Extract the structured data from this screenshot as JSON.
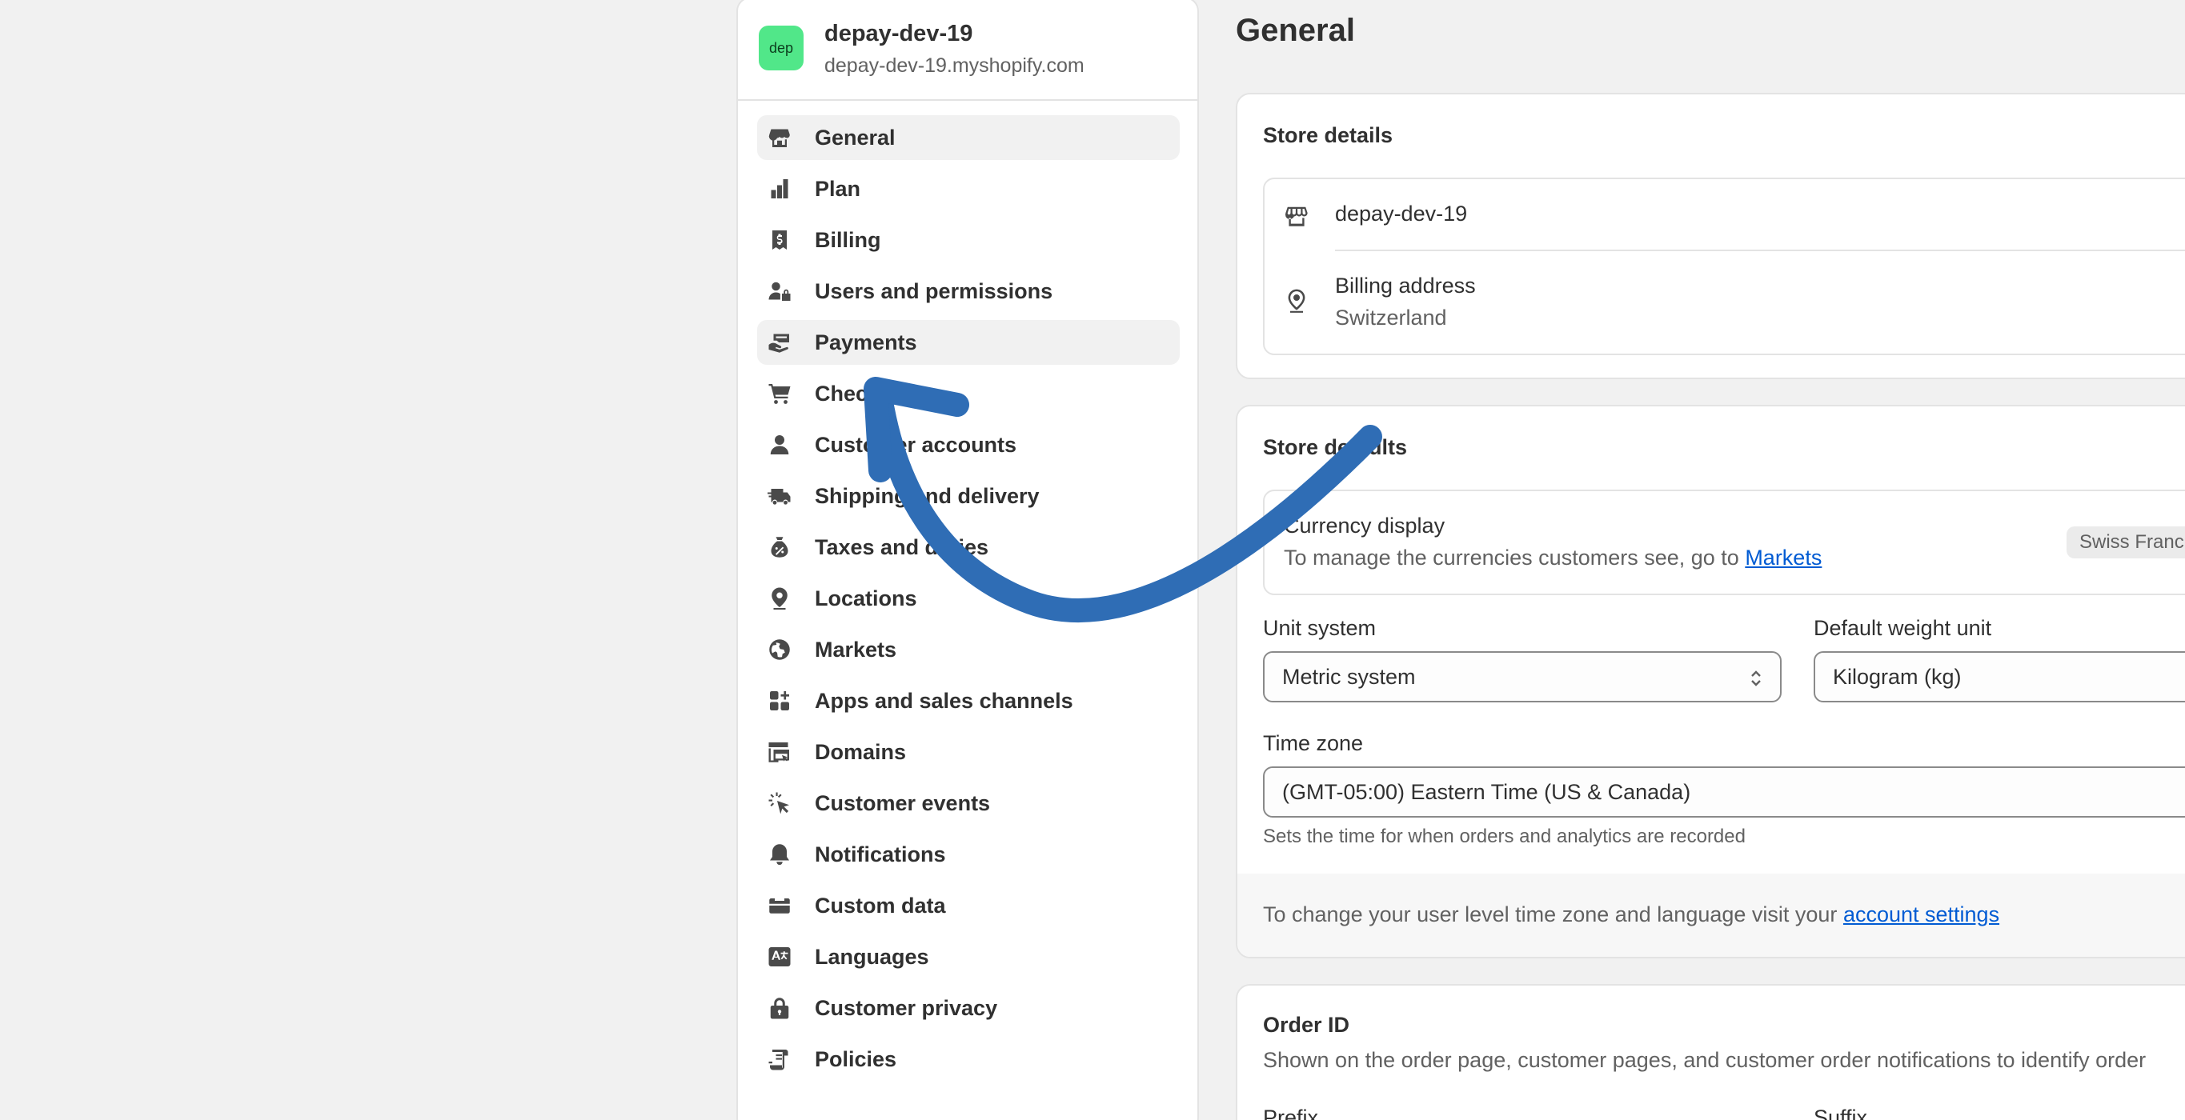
{
  "store": {
    "avatar": "dep",
    "name": "depay-dev-19",
    "domain": "depay-dev-19.myshopify.com"
  },
  "nav": {
    "items": [
      {
        "label": "General",
        "icon": "store-icon"
      },
      {
        "label": "Plan",
        "icon": "plan-chart-icon"
      },
      {
        "label": "Billing",
        "icon": "receipt-dollar-icon"
      },
      {
        "label": "Users and permissions",
        "icon": "users-lock-icon"
      },
      {
        "label": "Payments",
        "icon": "hand-card-icon"
      },
      {
        "label": "Checkout",
        "icon": "cart-icon"
      },
      {
        "label": "Customer accounts",
        "icon": "person-icon"
      },
      {
        "label": "Shipping and delivery",
        "icon": "truck-icon"
      },
      {
        "label": "Taxes and duties",
        "icon": "tax-bag-icon"
      },
      {
        "label": "Locations",
        "icon": "location-pin-icon"
      },
      {
        "label": "Markets",
        "icon": "globe-icon"
      },
      {
        "label": "Apps and sales channels",
        "icon": "apps-icon"
      },
      {
        "label": "Domains",
        "icon": "domains-icon"
      },
      {
        "label": "Customer events",
        "icon": "cursor-click-icon"
      },
      {
        "label": "Notifications",
        "icon": "bell-icon"
      },
      {
        "label": "Custom data",
        "icon": "database-icon"
      },
      {
        "label": "Languages",
        "icon": "translate-icon"
      },
      {
        "label": "Customer privacy",
        "icon": "lock-icon"
      },
      {
        "label": "Policies",
        "icon": "policy-scroll-icon"
      }
    ]
  },
  "main": {
    "title": "General",
    "store_details": {
      "title": "Store details",
      "store_name": "depay-dev-19",
      "billing_label": "Billing address",
      "billing_value": "Switzerland"
    },
    "store_defaults": {
      "title": "Store defaults",
      "currency_label": "Currency display",
      "currency_desc": "To manage the currencies customers see, go to",
      "currency_link": "Markets",
      "currency_badge": "Swiss Franc",
      "unit_label": "Unit system",
      "unit_value": "Metric system",
      "weight_label": "Default weight unit",
      "weight_value": "Kilogram (kg)",
      "tz_label": "Time zone",
      "tz_value": "(GMT-05:00) Eastern Time (US & Canada)",
      "tz_help": "Sets the time for when orders and analytics are recorded",
      "footer_text": "To change your user level time zone and language visit your",
      "footer_link": "account settings"
    },
    "order_id": {
      "title": "Order ID",
      "desc": "Shown on the order page, customer pages, and customer order notifications to identify order",
      "prefix_label": "Prefix",
      "suffix_label": "Suffix"
    }
  },
  "colors": {
    "avatar": "#51e789",
    "link": "#005bd3",
    "arrow": "#2f6db5"
  }
}
